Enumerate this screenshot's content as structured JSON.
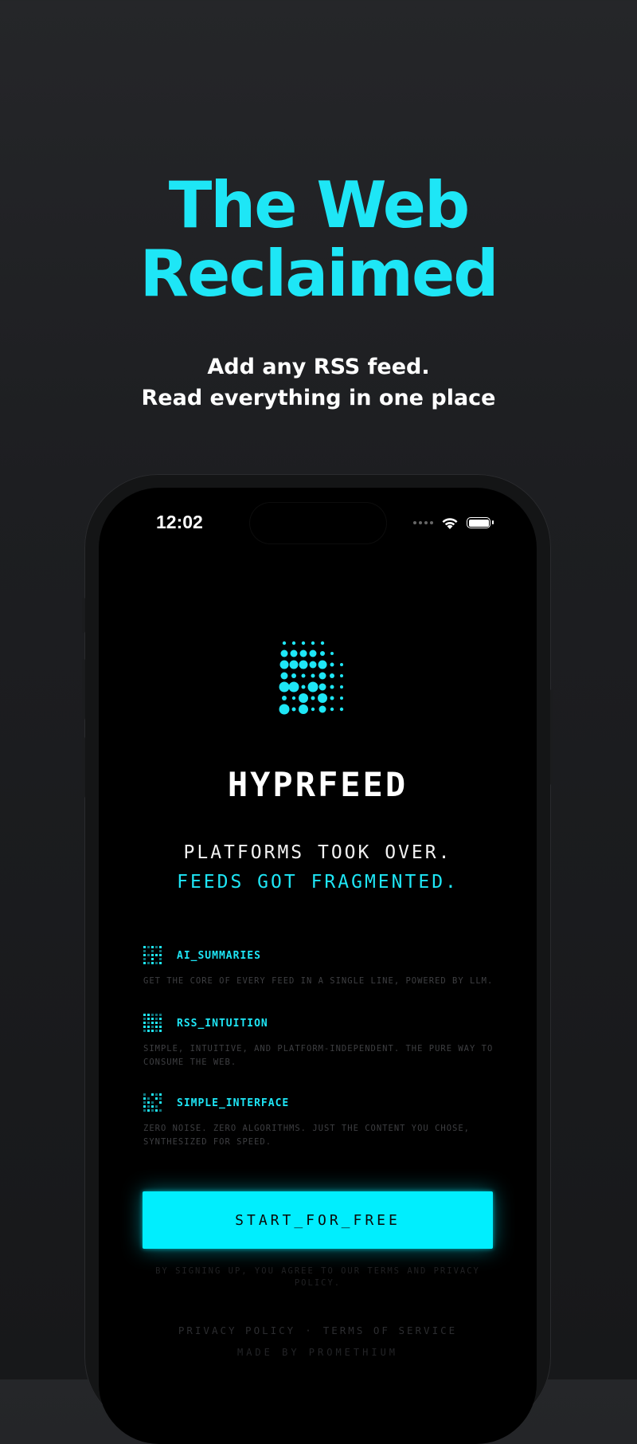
{
  "hero": {
    "title_line1": "The Web",
    "title_line2": "Reclaimed",
    "subtitle_line1": "Add any RSS feed.",
    "subtitle_line2": "Read everything in one place"
  },
  "status_bar": {
    "time": "12:02"
  },
  "app": {
    "brand": "HYPRFEED",
    "tagline_line1": "PLATFORMS TOOK OVER.",
    "tagline_line2": "FEEDS GOT FRAGMENTED.",
    "features": [
      {
        "title": "AI_SUMMARIES",
        "description": "GET THE CORE OF EVERY FEED IN A SINGLE LINE, POWERED BY LLM."
      },
      {
        "title": "RSS_INTUITION",
        "description": "SIMPLE, INTUITIVE, AND PLATFORM-INDEPENDENT. THE PURE WAY TO CONSUME THE WEB."
      },
      {
        "title": "SIMPLE_INTERFACE",
        "description": "ZERO NOISE. ZERO ALGORITHMS. JUST THE CONTENT YOU CHOSE, SYNTHESIZED FOR SPEED."
      }
    ],
    "cta_label": "START_FOR_FREE",
    "legal": "BY SIGNING UP, YOU AGREE TO OUR TERMS AND PRIVACY POLICY.",
    "footer": {
      "privacy": "PRIVACY POLICY",
      "separator": "·",
      "terms": "TERMS OF SERVICE",
      "made_by": "MADE BY PROMETHIUM"
    }
  },
  "colors": {
    "accent": "#1ee6f6",
    "button": "#00eefe",
    "background": "#1d1e21"
  }
}
